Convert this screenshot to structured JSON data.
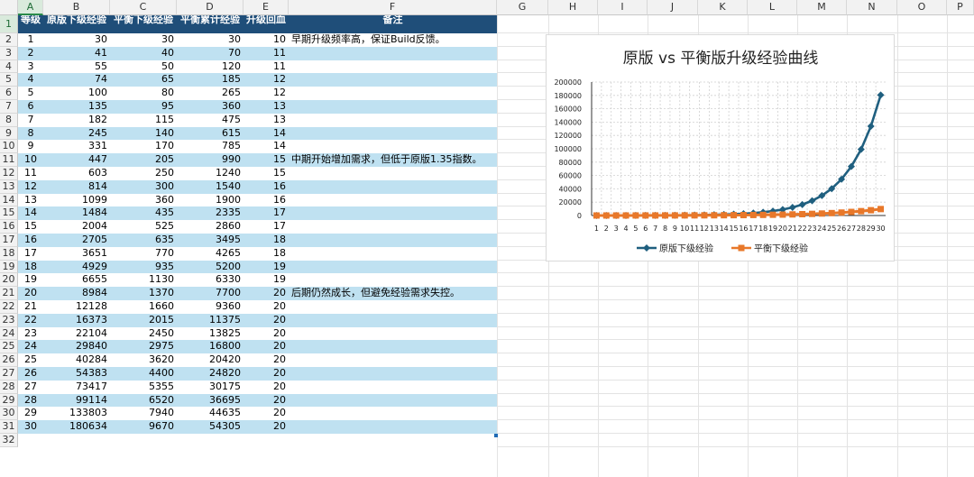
{
  "columns": [
    "A",
    "B",
    "C",
    "D",
    "E",
    "F",
    "G",
    "H",
    "I",
    "J",
    "K",
    "L",
    "M",
    "N",
    "O",
    "P"
  ],
  "selected_column": "A",
  "selected_row": 1,
  "rows": [
    "1",
    "2",
    "3",
    "4",
    "5",
    "6",
    "7",
    "8",
    "9",
    "10",
    "11",
    "12",
    "13",
    "14",
    "15",
    "16",
    "17",
    "18",
    "19",
    "20",
    "21",
    "22",
    "23",
    "24",
    "25",
    "26",
    "27",
    "28",
    "29",
    "30",
    "31",
    "32"
  ],
  "table": {
    "headers": [
      "等级",
      "原版下级经验",
      "平衡下级经验",
      "平衡累计经验",
      "升级回血",
      "备注"
    ],
    "rows": [
      [
        "1",
        "30",
        "30",
        "30",
        "10",
        "早期升级频率高，保证Build反馈。"
      ],
      [
        "2",
        "41",
        "40",
        "70",
        "11",
        ""
      ],
      [
        "3",
        "55",
        "50",
        "120",
        "11",
        ""
      ],
      [
        "4",
        "74",
        "65",
        "185",
        "12",
        ""
      ],
      [
        "5",
        "100",
        "80",
        "265",
        "12",
        ""
      ],
      [
        "6",
        "135",
        "95",
        "360",
        "13",
        ""
      ],
      [
        "7",
        "182",
        "115",
        "475",
        "13",
        ""
      ],
      [
        "8",
        "245",
        "140",
        "615",
        "14",
        ""
      ],
      [
        "9",
        "331",
        "170",
        "785",
        "14",
        ""
      ],
      [
        "10",
        "447",
        "205",
        "990",
        "15",
        "中期开始增加需求，但低于原版1.35指数。"
      ],
      [
        "11",
        "603",
        "250",
        "1240",
        "15",
        ""
      ],
      [
        "12",
        "814",
        "300",
        "1540",
        "16",
        ""
      ],
      [
        "13",
        "1099",
        "360",
        "1900",
        "16",
        ""
      ],
      [
        "14",
        "1484",
        "435",
        "2335",
        "17",
        ""
      ],
      [
        "15",
        "2004",
        "525",
        "2860",
        "17",
        ""
      ],
      [
        "16",
        "2705",
        "635",
        "3495",
        "18",
        ""
      ],
      [
        "17",
        "3651",
        "770",
        "4265",
        "18",
        ""
      ],
      [
        "18",
        "4929",
        "935",
        "5200",
        "19",
        ""
      ],
      [
        "19",
        "6655",
        "1130",
        "6330",
        "19",
        ""
      ],
      [
        "20",
        "8984",
        "1370",
        "7700",
        "20",
        "后期仍然成长，但避免经验需求失控。"
      ],
      [
        "21",
        "12128",
        "1660",
        "9360",
        "20",
        ""
      ],
      [
        "22",
        "16373",
        "2015",
        "11375",
        "20",
        ""
      ],
      [
        "23",
        "22104",
        "2450",
        "13825",
        "20",
        ""
      ],
      [
        "24",
        "29840",
        "2975",
        "16800",
        "20",
        ""
      ],
      [
        "25",
        "40284",
        "3620",
        "20420",
        "20",
        ""
      ],
      [
        "26",
        "54383",
        "4400",
        "24820",
        "20",
        ""
      ],
      [
        "27",
        "73417",
        "5355",
        "30175",
        "20",
        ""
      ],
      [
        "28",
        "99114",
        "6520",
        "36695",
        "20",
        ""
      ],
      [
        "29",
        "133803",
        "7940",
        "44635",
        "20",
        ""
      ],
      [
        "30",
        "180634",
        "9670",
        "54305",
        "20",
        ""
      ]
    ]
  },
  "colors": {
    "header_bg": "#1f4e79",
    "band": "#bfe1f1",
    "series1": "#1f5f7f",
    "series2": "#e8782a"
  },
  "chart_data": {
    "type": "line",
    "title": "原版 vs 平衡版升级经验曲线",
    "x": [
      1,
      2,
      3,
      4,
      5,
      6,
      7,
      8,
      9,
      10,
      11,
      12,
      13,
      14,
      15,
      16,
      17,
      18,
      19,
      20,
      21,
      22,
      23,
      24,
      25,
      26,
      27,
      28,
      29,
      30
    ],
    "y_ticks": [
      "0",
      "20000",
      "40000",
      "60000",
      "80000",
      "100000",
      "120000",
      "140000",
      "160000",
      "180000",
      "200000"
    ],
    "ylim": [
      0,
      200000
    ],
    "grid": true,
    "legend": "bottom",
    "series": [
      {
        "name": "原版下级经验",
        "marker": "diamond",
        "values": [
          30,
          41,
          55,
          74,
          100,
          135,
          182,
          245,
          331,
          447,
          603,
          814,
          1099,
          1484,
          2004,
          2705,
          3651,
          4929,
          6655,
          8984,
          12128,
          16373,
          22104,
          29840,
          40284,
          54383,
          73417,
          99114,
          133803,
          180634
        ]
      },
      {
        "name": "平衡下级经验",
        "marker": "square",
        "values": [
          30,
          40,
          50,
          65,
          80,
          95,
          115,
          140,
          170,
          205,
          250,
          300,
          360,
          435,
          525,
          635,
          770,
          935,
          1130,
          1370,
          1660,
          2015,
          2450,
          2975,
          3620,
          4400,
          5355,
          6520,
          7940,
          9670
        ]
      }
    ]
  }
}
